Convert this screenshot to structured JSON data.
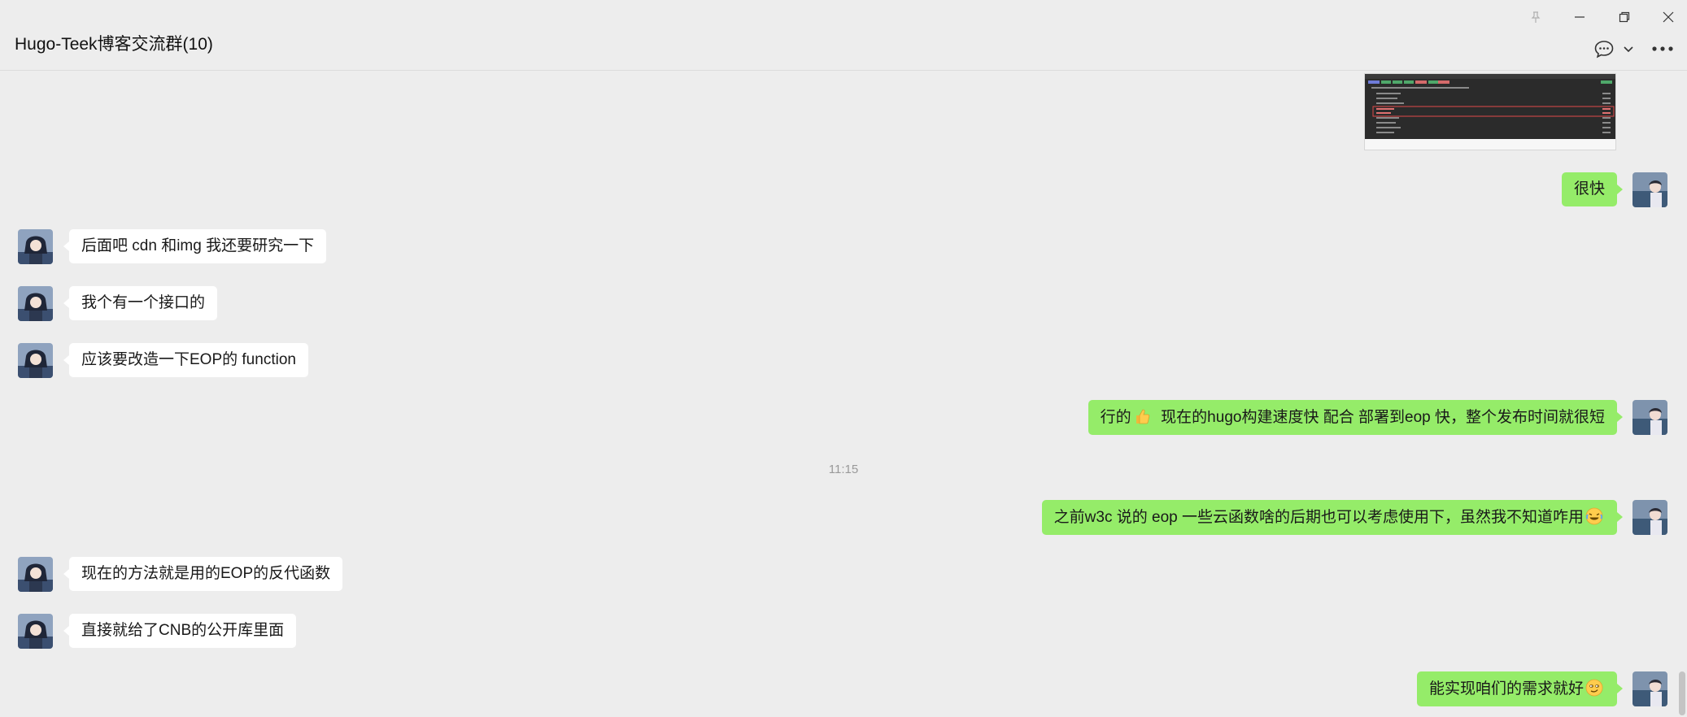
{
  "window": {
    "title": "Hugo-Teek博客交流群(10)"
  },
  "icons": {
    "pin": "pin-icon",
    "minimize": "minimize-icon",
    "restore": "restore-icon",
    "close": "close-icon",
    "chat": "chat-bubble-icon",
    "dropdown": "chevron-down-icon",
    "more": "more-icon"
  },
  "colors": {
    "background": "#ededed",
    "self_bubble": "#95ec69",
    "other_bubble": "#ffffff",
    "timestamp": "#999999"
  },
  "messages": [
    {
      "side": "right",
      "type": "image",
      "content": "screenshot-image"
    },
    {
      "side": "right",
      "type": "text",
      "text": "很快"
    },
    {
      "side": "left",
      "type": "text",
      "text": "后面吧 cdn 和img 我还要研究一下"
    },
    {
      "side": "left",
      "type": "text",
      "text": "我个有一个接口的"
    },
    {
      "side": "left",
      "type": "text",
      "text": "应该要改造一下EOP的 function"
    },
    {
      "side": "right",
      "type": "text",
      "text_before": "行的",
      "emoji": "thumbs-up",
      "text_after": "  现在的hugo构建速度快 配合 部署到eop 快，整个发布时间就很短"
    },
    {
      "side": "center",
      "type": "time",
      "text": "11:15"
    },
    {
      "side": "right",
      "type": "text",
      "text": "之前w3c 说的 eop 一些云函数啥的后期也可以考虑使用下，虽然我不知道咋用",
      "emoji": "laughing-tears"
    },
    {
      "side": "left",
      "type": "text",
      "text": "现在的方法就是用的EOP的反代函数"
    },
    {
      "side": "left",
      "type": "text",
      "text": "直接就给了CNB的公开库里面"
    },
    {
      "side": "right",
      "type": "text",
      "text": "能实现咱们的需求就好",
      "emoji": "smirk"
    }
  ]
}
